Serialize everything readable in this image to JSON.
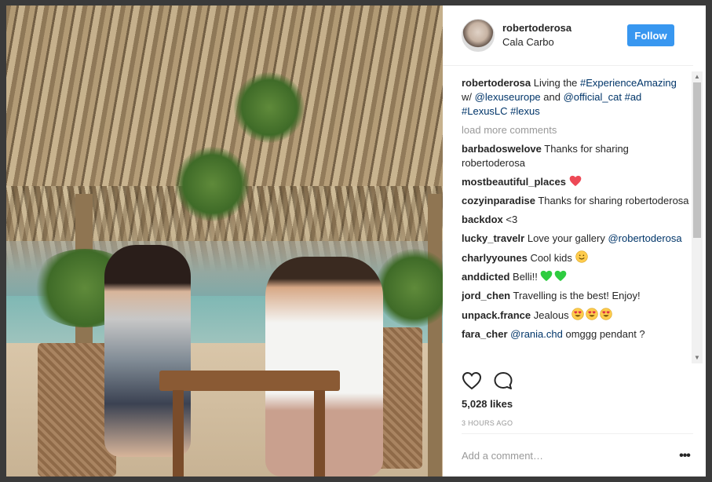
{
  "post": {
    "username": "robertoderosa",
    "location": "Cala Carbo",
    "follow_label": "Follow",
    "caption": {
      "user": "robertoderosa",
      "text_1": " Living the ",
      "tag_1": "#ExperienceAmazing",
      "text_2": " w/ ",
      "mention_1": "@lexuseurope",
      "text_3": " and ",
      "mention_2": "@official_cat",
      "text_4": " ",
      "tag_2": "#ad",
      "text_5": " ",
      "tag_3": "#LexusLC",
      "text_6": " ",
      "tag_4": "#lexus"
    },
    "load_more": "load more comments",
    "comments": [
      {
        "user": "barbadoswelove",
        "text": " Thanks for sharing robertoderosa"
      },
      {
        "user": "mostbeautiful_places",
        "text": " "
      },
      {
        "user": "cozyinparadise",
        "text": " Thanks for sharing robertoderosa"
      },
      {
        "user": "backdox",
        "text": " <3"
      },
      {
        "user": "lucky_travelr",
        "text": " Love your gallery ",
        "mention": "@robertoderosa"
      },
      {
        "user": "charlyyounes",
        "text": " Cool kids "
      },
      {
        "user": "anddicted",
        "text": " Belli!! "
      },
      {
        "user": "jord_chen",
        "text": " Travelling is the best! Enjoy!"
      },
      {
        "user": "unpack.france",
        "text": " Jealous "
      },
      {
        "user": "fara_cher",
        "text": " ",
        "mention": "@rania.chd",
        "text2": " omggg pendant ?"
      }
    ],
    "likes": "5,028 likes",
    "timestamp": "3 HOURS AGO",
    "add_comment_placeholder": "Add a comment…",
    "more_label": "•••"
  },
  "colors": {
    "accent": "#3897f0",
    "link": "#003569",
    "heart_red": "#ed4956",
    "heart_green": "#2ecc40",
    "emoji_yellow": "#ffcc4d"
  }
}
